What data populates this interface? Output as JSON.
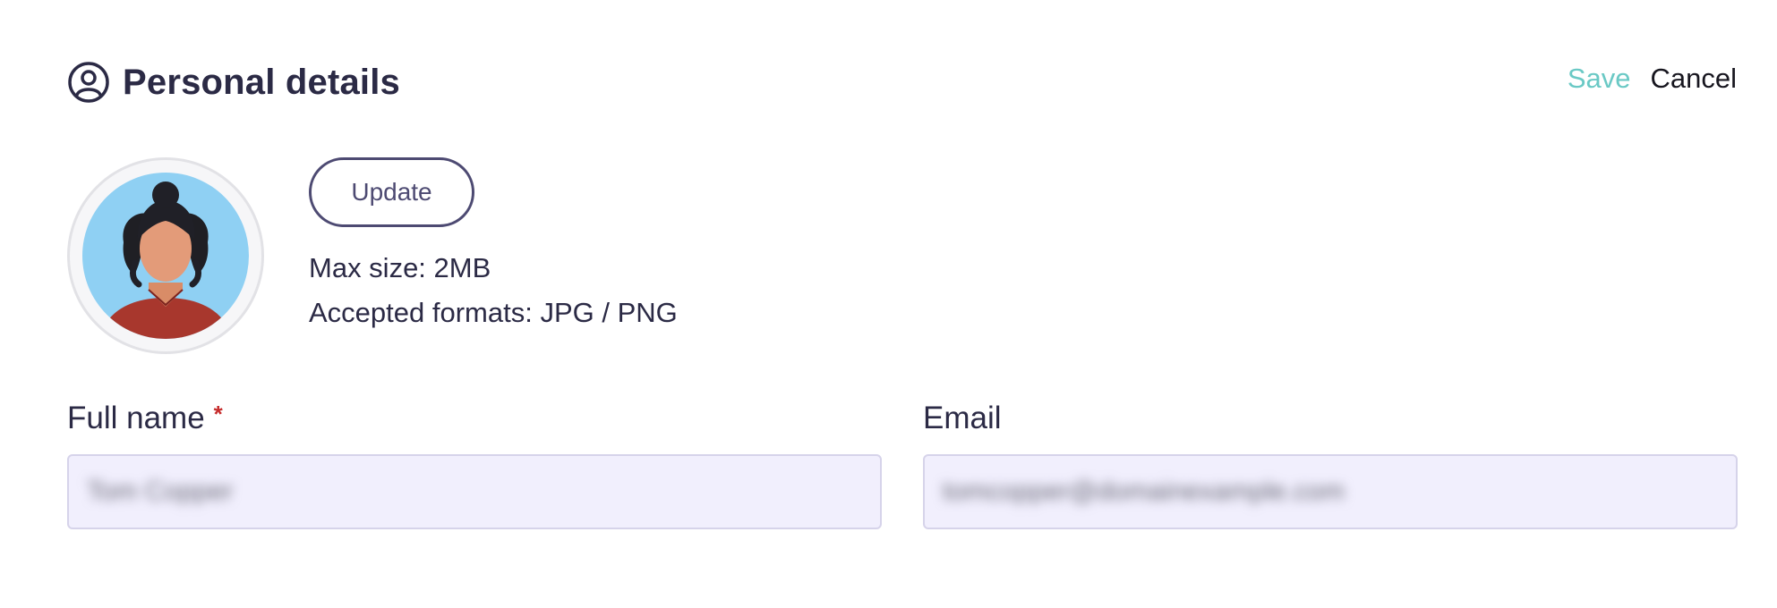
{
  "header": {
    "title": "Personal details",
    "save_label": "Save",
    "cancel_label": "Cancel"
  },
  "avatar_section": {
    "update_label": "Update",
    "max_size": "Max size: 2MB",
    "formats": "Accepted formats: JPG / PNG"
  },
  "form": {
    "full_name": {
      "label": "Full name",
      "required_marker": "*",
      "value": "Tom Copper"
    },
    "email": {
      "label": "Email",
      "value": "tomcopper@domainexample.com"
    }
  },
  "icons": {
    "title_icon": "user-circle-icon"
  },
  "colors": {
    "text": "#2b2a45",
    "accent_save": "#6ac9c5",
    "required": "#c62c2c",
    "input_bg": "#f1effd",
    "input_border": "#d6d3ea",
    "button_border": "#4d4a72"
  }
}
